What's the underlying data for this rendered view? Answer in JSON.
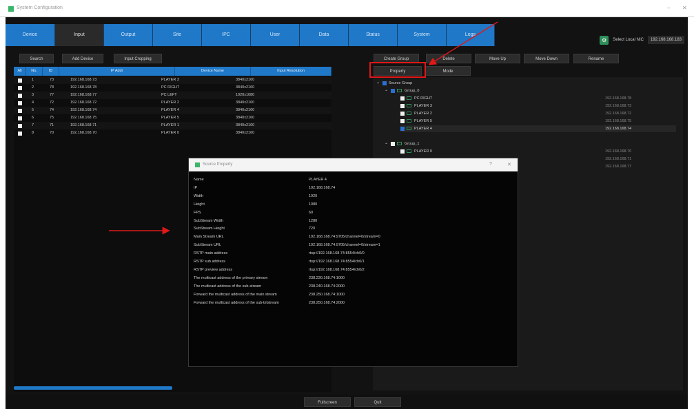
{
  "window": {
    "title": "System Configuration",
    "min": "–",
    "close": "✕"
  },
  "tabs": [
    "Device",
    "Input",
    "Output",
    "Site",
    "IPC",
    "User",
    "Data",
    "Status",
    "System",
    "Logs"
  ],
  "active_tab": "Input",
  "nic": {
    "label": "Select Local NIC",
    "value": "192.168.168.183"
  },
  "left_toolbar": {
    "search": "Search",
    "add_device": "Add Device",
    "input_cropping": "Input Cropping"
  },
  "table": {
    "headers": [
      "All",
      "No.",
      "ID",
      "IP Addr",
      "Device Name",
      "Input Resolution"
    ],
    "rows": [
      {
        "no": "1",
        "id": "73",
        "ip": "192.168.168.73",
        "name": "PLAYER 3",
        "res": "3840x2160"
      },
      {
        "no": "2",
        "id": "78",
        "ip": "192.168.168.78",
        "name": "PC RIGHT",
        "res": "3840x2160"
      },
      {
        "no": "3",
        "id": "77",
        "ip": "192.168.168.77",
        "name": "PC LEFT",
        "res": "1920x1080"
      },
      {
        "no": "4",
        "id": "72",
        "ip": "192.168.168.72",
        "name": "PLAYER 2",
        "res": "3840x2160"
      },
      {
        "no": "5",
        "id": "74",
        "ip": "192.168.168.74",
        "name": "PLAYER 4",
        "res": "3840x2160"
      },
      {
        "no": "6",
        "id": "75",
        "ip": "192.168.168.75",
        "name": "PLAYER 5",
        "res": "3840x2160"
      },
      {
        "no": "7",
        "id": "71",
        "ip": "192.168.168.71",
        "name": "PLAYER 1",
        "res": "3840x2160"
      },
      {
        "no": "8",
        "id": "70",
        "ip": "192.168.168.70",
        "name": "PLAYER 0",
        "res": "3840x2160"
      }
    ]
  },
  "right_toolbar": {
    "create_group": "Create Group",
    "delete": "Delete",
    "move_up": "Move Up",
    "move_down": "Move Down",
    "rename": "Rename",
    "property": "Property",
    "mode": "Mode"
  },
  "tree": {
    "root": "Source Group",
    "group0": "Group_0",
    "group0_items": [
      {
        "name": "PC RIGHT",
        "ip": "192.168.168.78"
      },
      {
        "name": "PLAYER 3",
        "ip": "192.168.168.73"
      },
      {
        "name": "PLAYER 2",
        "ip": "192.168.168.72"
      },
      {
        "name": "PLAYER 5",
        "ip": "192.168.168.75"
      },
      {
        "name": "PLAYER 4",
        "ip": "192.168.168.74"
      }
    ],
    "group1": "Group_1",
    "group1_items": [
      {
        "name": "PLAYER 0",
        "ip": "192.168.168.70"
      },
      {
        "name": "",
        "ip": "192.168.168.71"
      },
      {
        "name": "",
        "ip": "192.168.168.77"
      }
    ]
  },
  "dialog": {
    "title": "Source Property",
    "help": "?",
    "close": "✕",
    "properties": [
      {
        "label": "Name",
        "value": "PLAYER 4"
      },
      {
        "label": "IP",
        "value": "192.168.168.74"
      },
      {
        "label": "Width",
        "value": "1920"
      },
      {
        "label": "Height",
        "value": "1080"
      },
      {
        "label": "FPS",
        "value": "60"
      },
      {
        "label": "SubStream Width",
        "value": "1280"
      },
      {
        "label": "SubStream Height",
        "value": "720"
      },
      {
        "label": "Main Stream URL",
        "value": "192.168.168.74:9705/channel=0/stream=0"
      },
      {
        "label": "SubStream URL",
        "value": "192.168.168.74:9705/channel=0/stream=1"
      },
      {
        "label": "RSTP main address",
        "value": "rtsp://192.168.168.74:8554/ch0/0"
      },
      {
        "label": "RSTP sub address",
        "value": "rtsp://192.168.168.74:8554/ch0/1"
      },
      {
        "label": "RSTP preview address",
        "value": "rtsp://192.168.168.74:8554/ch0/2"
      },
      {
        "label": "The multicast address of the primary stream",
        "value": "238.230.168.74:1000"
      },
      {
        "label": "The multicast address of the sub-stream",
        "value": "238.240.168.74:2000"
      },
      {
        "label": "Forward the multicast address of the main stream",
        "value": "238.250.168.74:1000"
      },
      {
        "label": "Forward the multicast address of the sub-bitstream",
        "value": "238.250.168.74:2000"
      }
    ]
  },
  "bottom": {
    "fullscreen": "Fullscreen",
    "quit": "Quit"
  },
  "colors": {
    "accent": "#1f78c8",
    "highlight": "#e01818",
    "background": "#121212"
  }
}
